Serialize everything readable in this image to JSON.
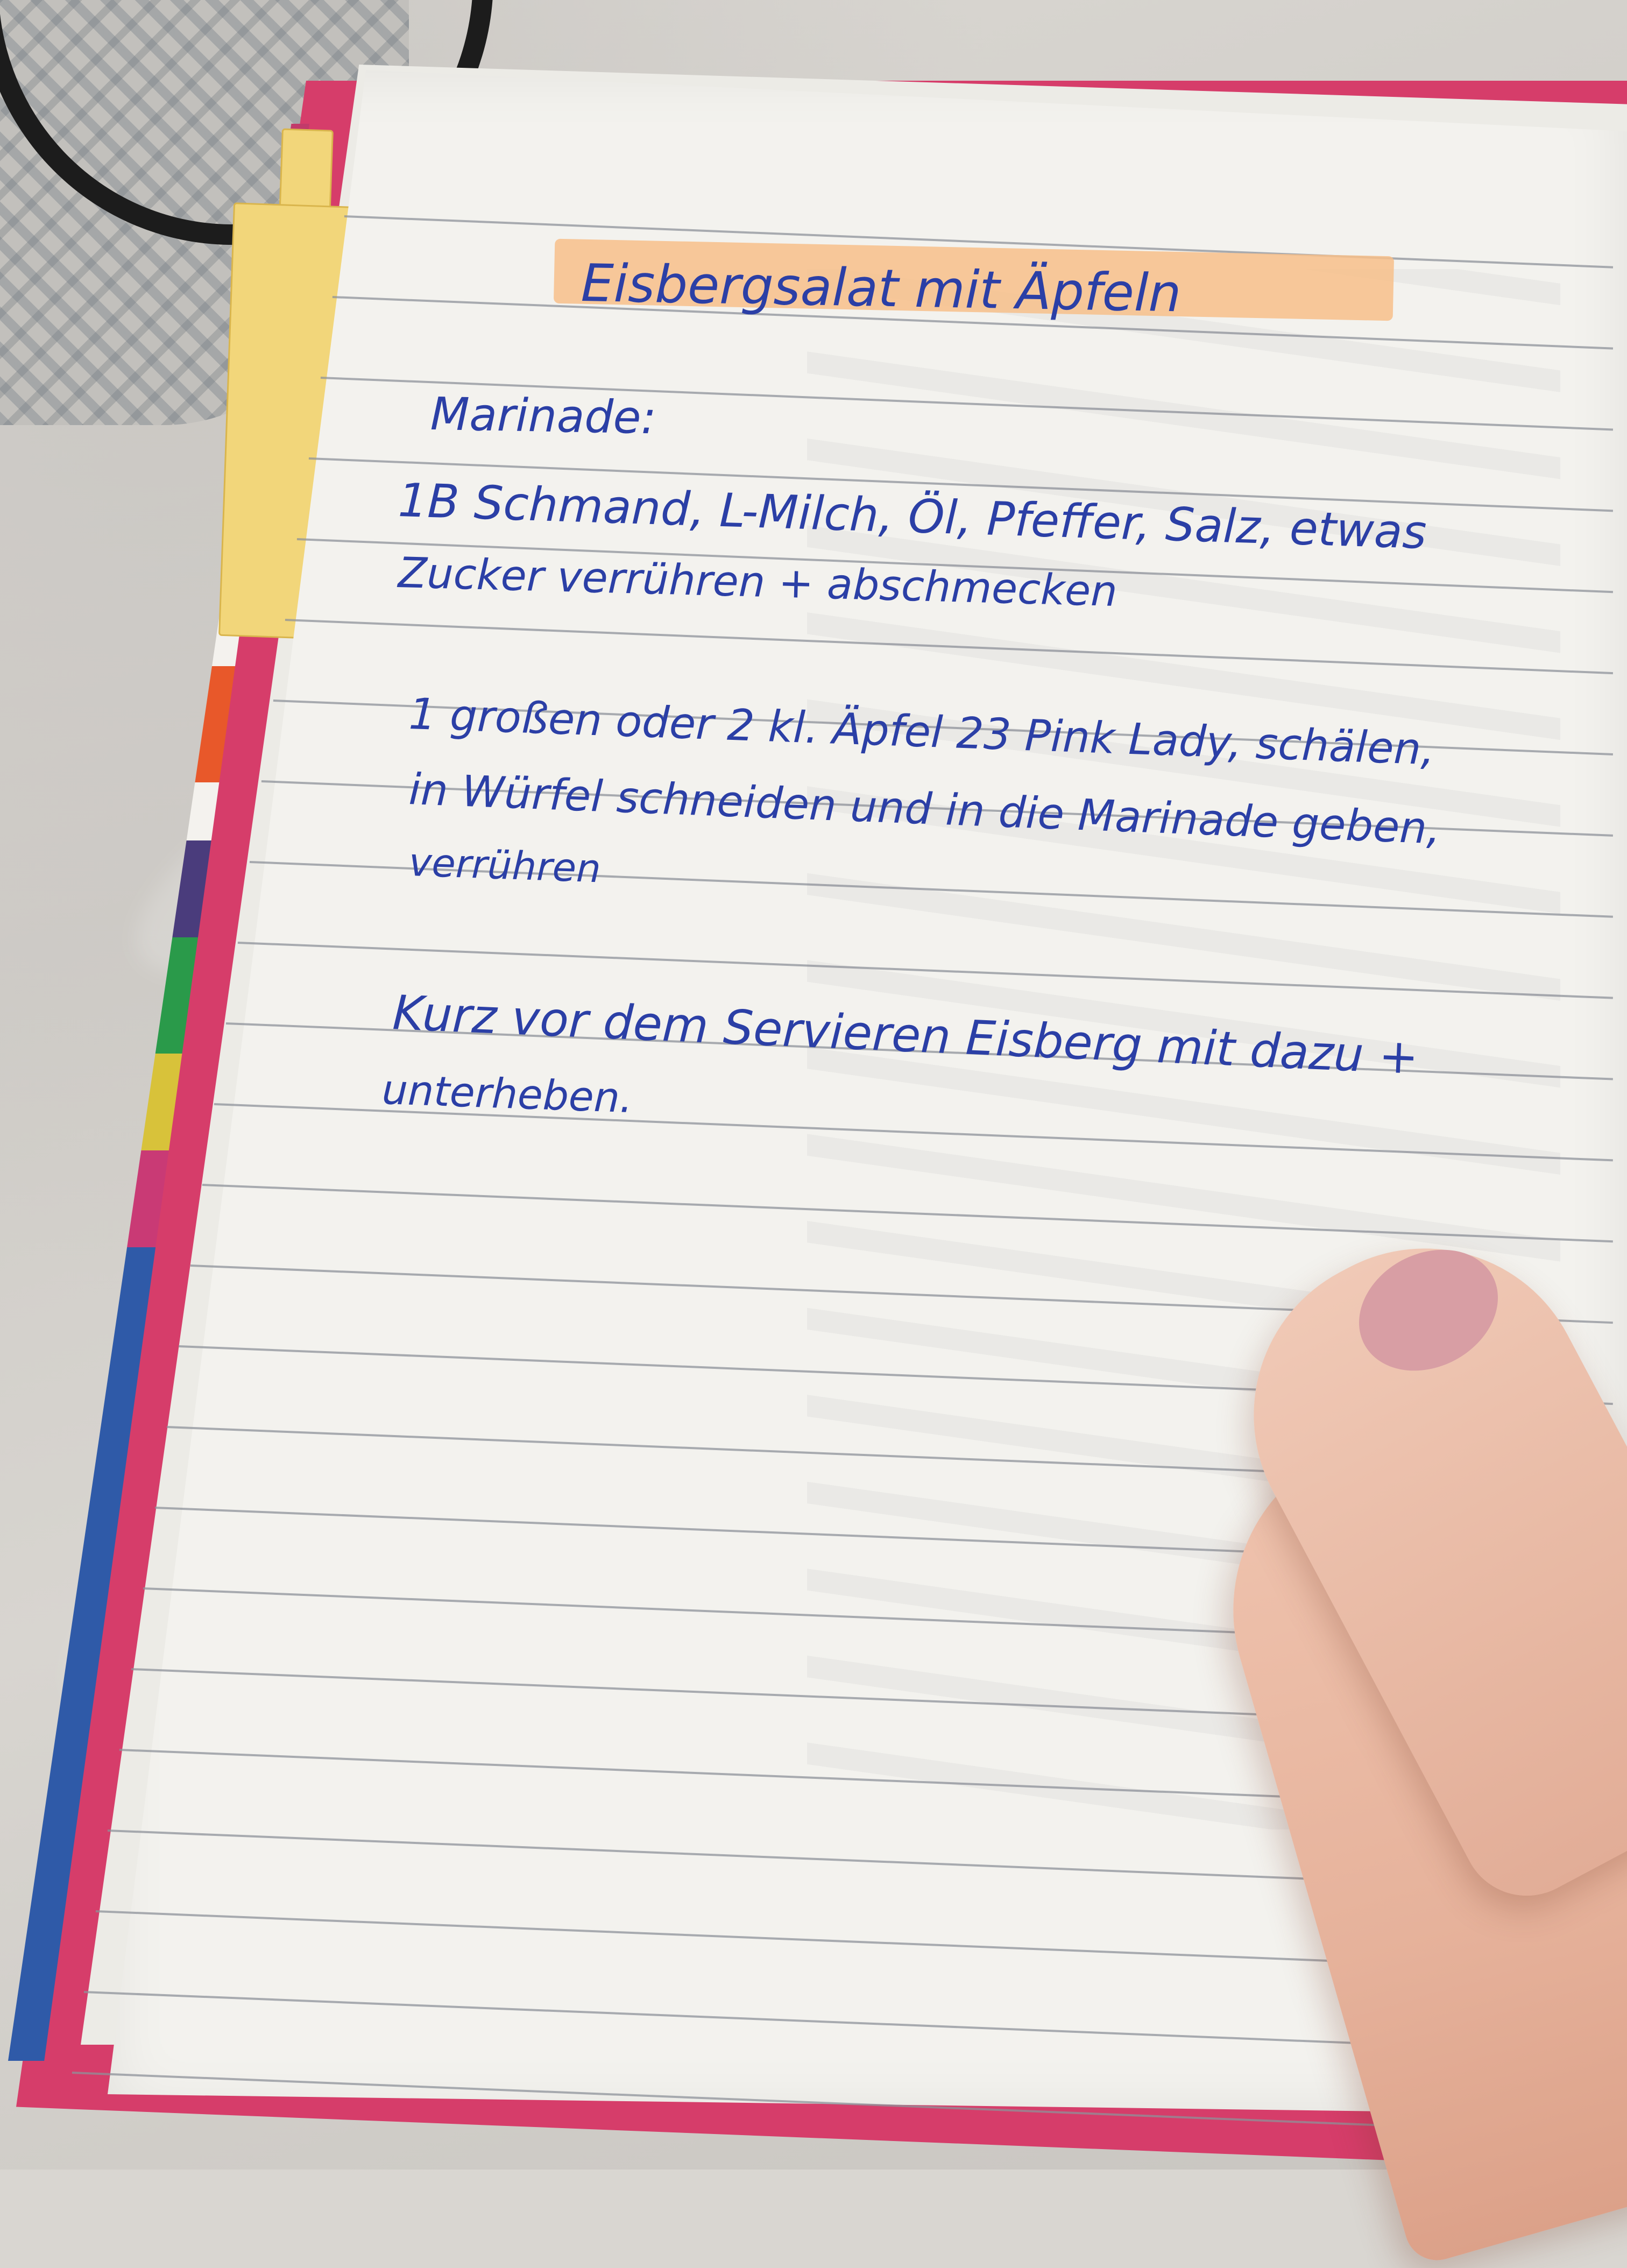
{
  "notebook": {
    "title": "Eisbergsalat mit Äpfeln",
    "marinade_heading": "Marinade:",
    "marinade_lines": [
      "1B Schmand, L-Milch, Öl, Pfeffer, Salz, etwas",
      "Zucker verrühren + abschmecken"
    ],
    "apple_lines": [
      "1 großen oder 2 kl. Äpfel 23 Pink Lady, schälen,",
      "in Würfel schneiden und in die Marinade geben,",
      "verrühren"
    ],
    "serve_lines": [
      "Kurz vor dem Servieren Eisberg mit dazu +",
      "unterheben."
    ]
  },
  "colors": {
    "ink": "#2b3fa6",
    "highlight": "#f7c08a",
    "cover": "#d63d6a",
    "tab": "#f2d67a"
  }
}
